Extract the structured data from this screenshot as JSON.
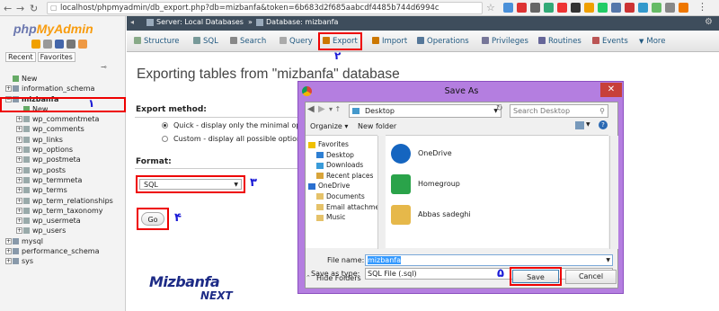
{
  "browser": {
    "url": "localhost/phpmyadmin/db_export.php?db=mizbanfa&token=6b683d2f685aabcdf4485b744d6994c"
  },
  "sidebar": {
    "logo_php": "php",
    "logo_my": "MyAdmin",
    "tab_recent": "Recent",
    "tab_favorites": "Favorites",
    "items": [
      {
        "label": "New",
        "depth": 0
      },
      {
        "label": "information_schema",
        "depth": 0
      },
      {
        "label": "mizbanfa",
        "depth": 0
      },
      {
        "label": "New",
        "depth": 1
      },
      {
        "label": "wp_commentmeta",
        "depth": 1
      },
      {
        "label": "wp_comments",
        "depth": 1
      },
      {
        "label": "wp_links",
        "depth": 1
      },
      {
        "label": "wp_options",
        "depth": 1
      },
      {
        "label": "wp_postmeta",
        "depth": 1
      },
      {
        "label": "wp_posts",
        "depth": 1
      },
      {
        "label": "wp_termmeta",
        "depth": 1
      },
      {
        "label": "wp_terms",
        "depth": 1
      },
      {
        "label": "wp_term_relationships",
        "depth": 1
      },
      {
        "label": "wp_term_taxonomy",
        "depth": 1
      },
      {
        "label": "wp_usermeta",
        "depth": 1
      },
      {
        "label": "wp_users",
        "depth": 1
      },
      {
        "label": "mysql",
        "depth": 0
      },
      {
        "label": "performance_schema",
        "depth": 0
      },
      {
        "label": "sys",
        "depth": 0
      }
    ]
  },
  "breadcrumb": {
    "server": "Server: Local Databases",
    "sep": "»",
    "database": "Database: mizbanfa"
  },
  "tabs": [
    "Structure",
    "SQL",
    "Search",
    "Query",
    "Export",
    "Import",
    "Operations",
    "Privileges",
    "Routines",
    "Events",
    "More"
  ],
  "main": {
    "heading": "Exporting tables from \"mizbanfa\" database",
    "export_method_label": "Export method:",
    "quick_option": "Quick - display only the minimal options",
    "custom_option": "Custom - display all possible options",
    "format_label": "Format:",
    "format_value": "SQL",
    "go_button": "Go"
  },
  "annotations": {
    "n1": "۱",
    "n2": "۲",
    "n3": "۳",
    "n4": "۴",
    "n5": "۵"
  },
  "watermark": {
    "top": "Mizbanfa",
    "bottom": "NEXT"
  },
  "dialog": {
    "title": "Save As",
    "path": "Desktop",
    "search_placeholder": "Search Desktop",
    "organize": "Organize ▾",
    "new_folder": "New folder",
    "nav": [
      {
        "label": "Favorites",
        "indent": 0
      },
      {
        "label": "Desktop",
        "indent": 1
      },
      {
        "label": "Downloads",
        "indent": 1
      },
      {
        "label": "Recent places",
        "indent": 1
      },
      {
        "label": "OneDrive",
        "indent": 0
      },
      {
        "label": "Documents",
        "indent": 1
      },
      {
        "label": "Email attachmen",
        "indent": 1
      },
      {
        "label": "Music",
        "indent": 1
      }
    ],
    "files": [
      "OneDrive",
      "Homegroup",
      "Abbas sadeghi"
    ],
    "file_name_label": "File name:",
    "file_name_value": "mizbanfa",
    "save_type_label": "Save as type:",
    "save_type_value": "SQL File (.sql)",
    "hide_folders": "Hide Folders",
    "save_button": "Save",
    "cancel_button": "Cancel"
  }
}
